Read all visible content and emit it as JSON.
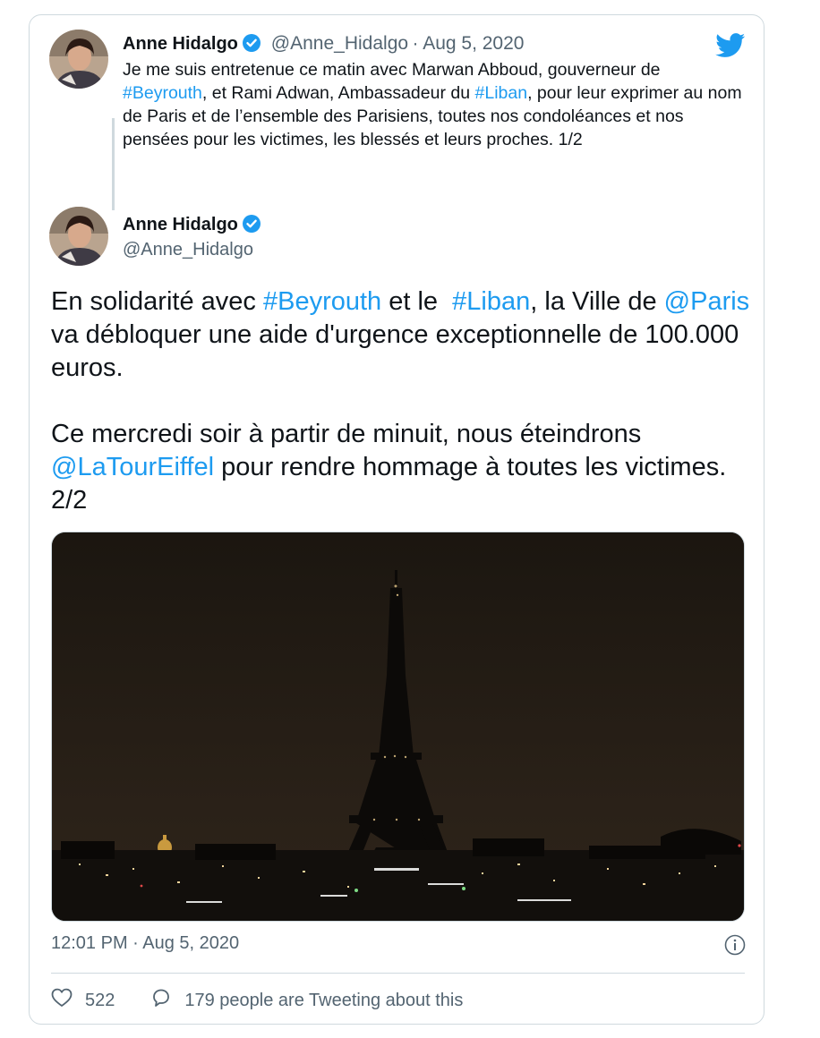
{
  "quoted": {
    "author_name": "Anne Hidalgo",
    "handle": "@Anne_Hidalgo",
    "date": "Aug 5, 2020",
    "text_parts": [
      {
        "text": "Je me suis entretenue ce matin avec Marwan Abboud, gouverneur de "
      },
      {
        "text": "#Beyrouth",
        "link": true
      },
      {
        "text": ", et Rami Adwan, Ambassadeur du "
      },
      {
        "text": "#Liban",
        "link": true
      },
      {
        "text": ", pour leur exprimer au nom de Paris et de l’ensemble des Parisiens, toutes nos condoléances et nos pensées pour les victimes, les blessés et leurs proches. 1/2"
      }
    ]
  },
  "tweet": {
    "author_name": "Anne Hidalgo",
    "handle": "@Anne_Hidalgo",
    "paragraph1": [
      {
        "text": "En solidarité avec "
      },
      {
        "text": "#Beyrouth",
        "link": true
      },
      {
        "text": " et le  "
      },
      {
        "text": "#Liban",
        "link": true
      },
      {
        "text": ", la Ville de "
      },
      {
        "text": "@Paris",
        "link": true
      },
      {
        "text": " va débloquer une aide d'urgence exceptionnelle de 100.000 euros."
      }
    ],
    "paragraph2": [
      {
        "text": "Ce mercredi soir à partir de minuit, nous éteindrons "
      },
      {
        "text": "@LaTourEiffel",
        "link": true
      },
      {
        "text": " pour rendre hommage à toutes les victimes. 2/2"
      }
    ],
    "timestamp": "12:01 PM · Aug 5, 2020",
    "likes": "522",
    "tweeting_about": "179 people are Tweeting about this"
  },
  "colors": {
    "link": "#1d9bf0",
    "verified": "#1d9bf0",
    "secondary_text": "#536471",
    "border": "#cfd9de"
  },
  "icons": [
    "twitter-bird-icon",
    "verified-badge-icon",
    "info-icon",
    "heart-icon",
    "reply-bubble-icon"
  ]
}
